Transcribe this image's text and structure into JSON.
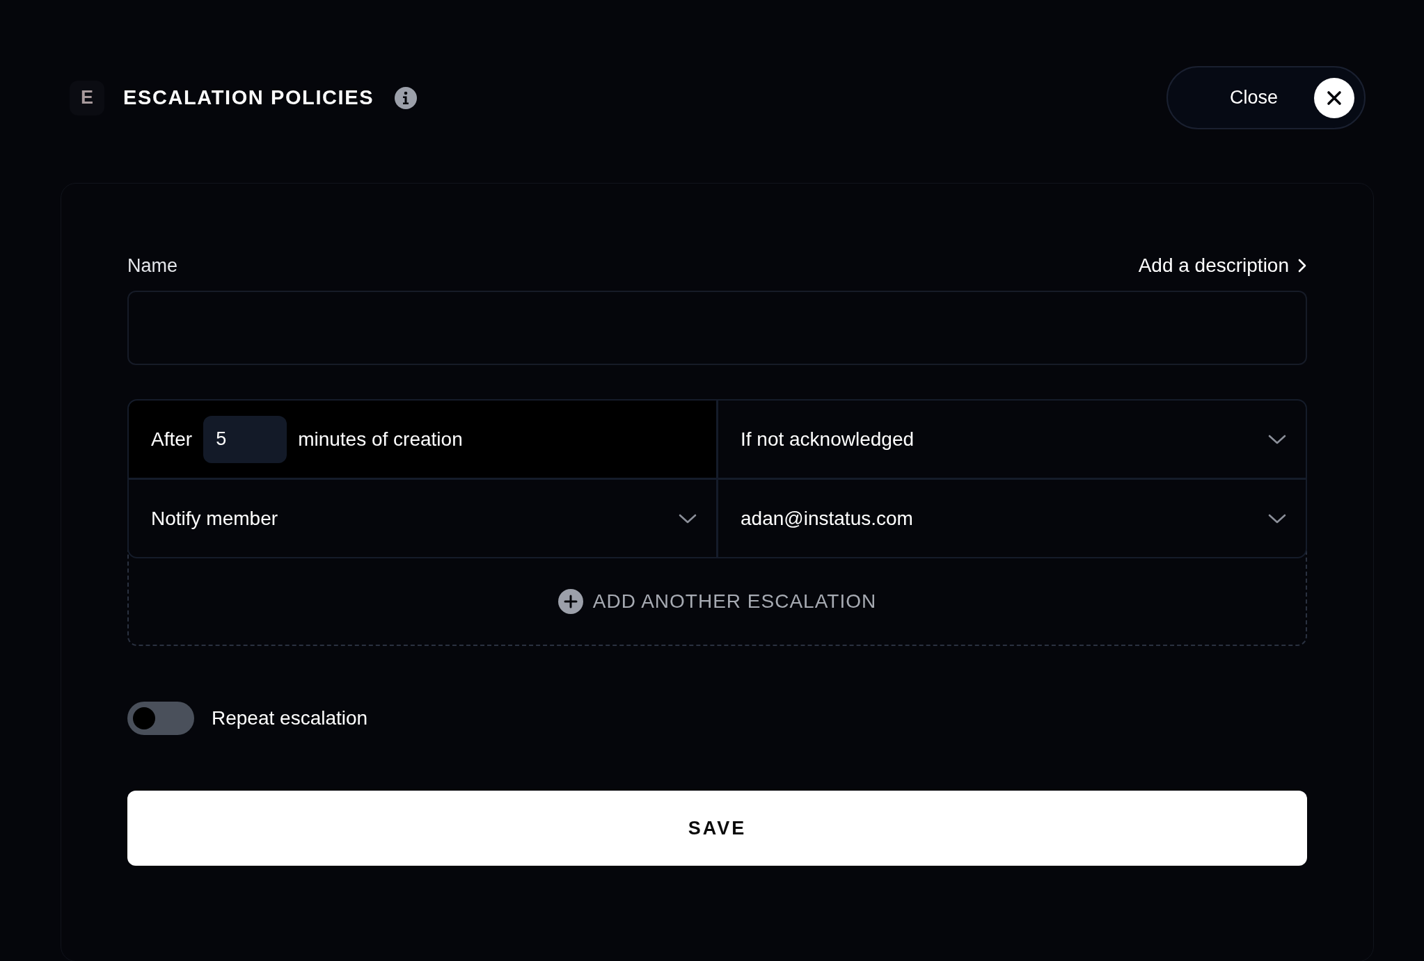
{
  "header": {
    "logo_letter": "E",
    "title": "ESCALATION POLICIES",
    "close_label": "Close"
  },
  "form": {
    "name_label": "Name",
    "description_link": "Add a description",
    "escalation": {
      "after_label": "After",
      "minutes": "5",
      "minutes_suffix": "minutes of creation",
      "condition": "If not acknowledged",
      "action": "Notify member",
      "target": "adan@instatus.com"
    },
    "add_label": "ADD ANOTHER ESCALATION",
    "repeat": {
      "label": "Repeat escalation",
      "on": false
    },
    "save_label": "SAVE"
  }
}
